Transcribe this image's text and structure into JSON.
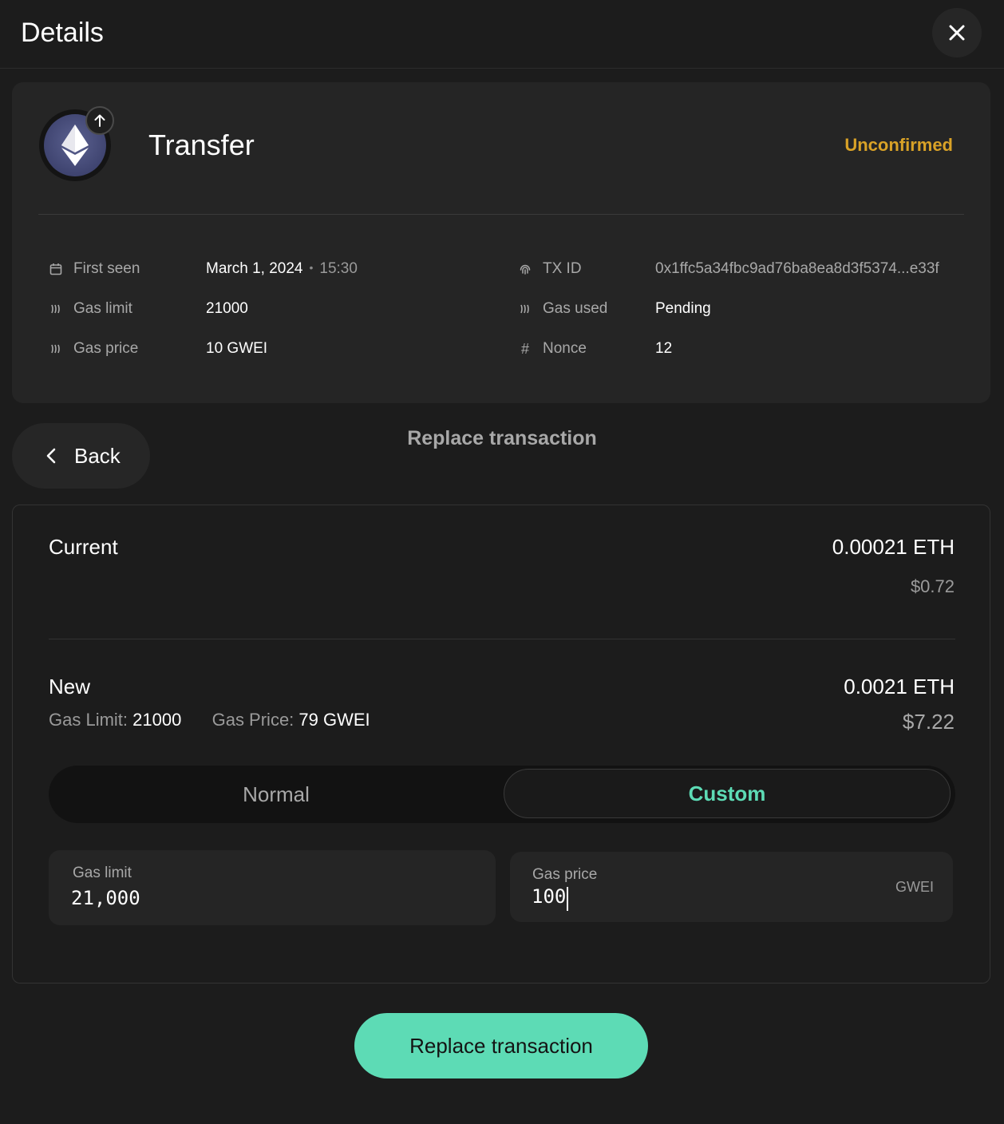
{
  "header": {
    "title": "Details",
    "close_icon": "close-icon"
  },
  "summary": {
    "tx_type": "Transfer",
    "status": "Unconfirmed",
    "status_color": "#d9a227",
    "token_icon": "ethereum-icon",
    "badge_icon": "arrow-up-icon",
    "details": {
      "first_seen_label": "First seen",
      "first_seen_date": "March 1, 2024",
      "first_seen_time": "15:30",
      "gas_limit_label": "Gas limit",
      "gas_limit_value": "21000",
      "gas_price_label": "Gas price",
      "gas_price_value": "10 GWEI",
      "tx_id_label": "TX ID",
      "tx_id_value": "0x1ffc5a34fbc9ad76ba8ea8d3f5374...e33f",
      "gas_used_label": "Gas used",
      "gas_used_value": "Pending",
      "nonce_label": "Nonce",
      "nonce_value": "12"
    }
  },
  "nav": {
    "back_label": "Back",
    "section_title": "Replace transaction"
  },
  "replace": {
    "current_label": "Current",
    "current_amount": "0.00021 ETH",
    "current_fiat": "$0.72",
    "new_label": "New",
    "new_gas_limit_label": "Gas Limit:",
    "new_gas_limit_value": "21000",
    "new_gas_price_label": "Gas Price:",
    "new_gas_price_value": "79 GWEI",
    "new_amount": "0.0021 ETH",
    "new_fiat": "$7.22",
    "toggle": {
      "normal": "Normal",
      "custom": "Custom",
      "selected": "Custom"
    },
    "fields": {
      "gas_limit_label": "Gas limit",
      "gas_limit_value": "21,000",
      "gas_price_label": "Gas price",
      "gas_price_value": "100",
      "gas_price_unit": "GWEI"
    },
    "submit_label": "Replace transaction"
  },
  "colors": {
    "accent": "#5ddbb5",
    "warning": "#d9a227",
    "background": "#1c1c1c"
  }
}
